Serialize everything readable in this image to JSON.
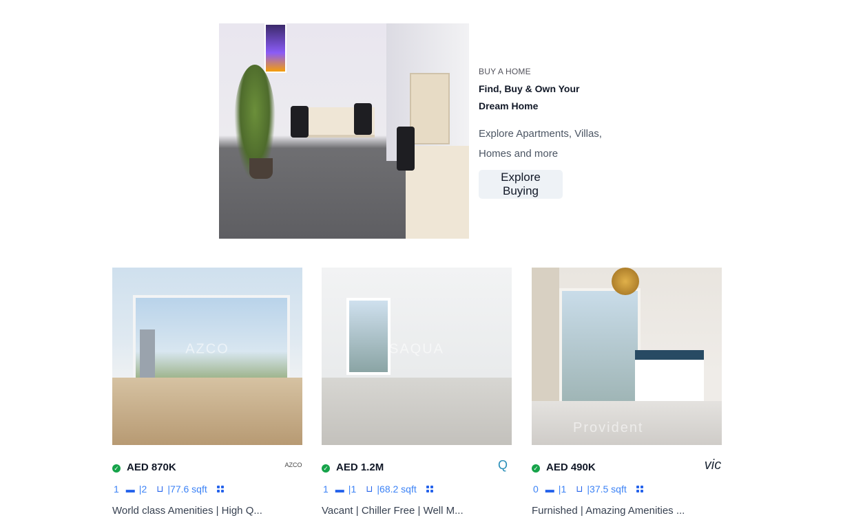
{
  "hero": {
    "eyebrow": "BUY A HOME",
    "title": "Find, Buy & Own Your Dream Home",
    "description": "Explore Apartments, Villas, Homes and more",
    "button_label": "Explore Buying"
  },
  "listings": [
    {
      "price": "AED 870K",
      "bedrooms": "1",
      "bathrooms": "2",
      "area": "77.6 sqft",
      "description": "World class Amenities | High Q...",
      "agency_logo_text": "AZCO",
      "watermark": "AZCO"
    },
    {
      "price": "AED 1.2M",
      "bedrooms": "1",
      "bathrooms": "1",
      "area": "68.2 sqft",
      "description": "Vacant | Chiller Free | Well M...",
      "agency_logo_text": "Q",
      "watermark": "SAQUA"
    },
    {
      "price": "AED 490K",
      "bedrooms": "0",
      "bathrooms": "1",
      "area": "37.5 sqft",
      "description": "Furnished | Amazing Amenities ...",
      "agency_logo_text": "vic",
      "watermark": "Provident"
    }
  ],
  "icons": {
    "verified": "check-circle-icon",
    "bed": "bed-icon",
    "bath": "bath-icon",
    "floorplan": "grid-icon"
  },
  "colors": {
    "accent": "#2563eb",
    "verified": "#16a34a",
    "button_bg": "#eef2f6"
  }
}
